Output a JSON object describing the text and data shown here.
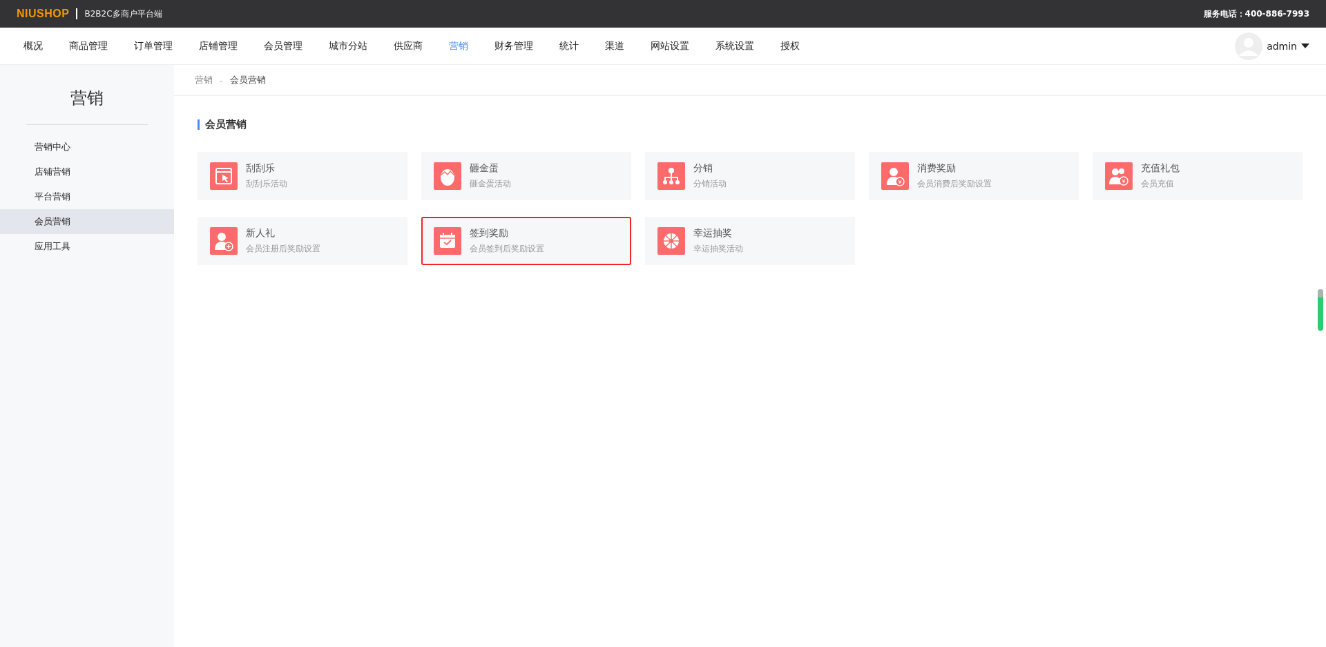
{
  "header": {
    "logo": "NIUSHOP",
    "subtitle": "B2B2C多商户平台端",
    "service_phone": "服务电话：400-886-7993"
  },
  "nav": [
    {
      "label": "概况",
      "selected": false
    },
    {
      "label": "商品管理",
      "selected": false
    },
    {
      "label": "订单管理",
      "selected": false
    },
    {
      "label": "店铺管理",
      "selected": false
    },
    {
      "label": "会员管理",
      "selected": false
    },
    {
      "label": "城市分站",
      "selected": false
    },
    {
      "label": "供应商",
      "selected": false
    },
    {
      "label": "营销",
      "selected": true
    },
    {
      "label": "财务管理",
      "selected": false
    },
    {
      "label": "统计",
      "selected": false
    },
    {
      "label": "渠道",
      "selected": false
    },
    {
      "label": "网站设置",
      "selected": false
    },
    {
      "label": "系统设置",
      "selected": false
    },
    {
      "label": "授权",
      "selected": false
    }
  ],
  "user": {
    "name": "admin"
  },
  "sidebar": {
    "title": "营销",
    "items": [
      {
        "label": "营销中心",
        "selected": false
      },
      {
        "label": "店铺营销",
        "selected": false
      },
      {
        "label": "平台营销",
        "selected": false
      },
      {
        "label": "会员营销",
        "selected": true
      },
      {
        "label": "应用工具",
        "selected": false
      }
    ]
  },
  "breadcrumb": [
    "营销",
    "会员营销"
  ],
  "breadcrumb_separator": "-",
  "section": {
    "title": "会员营销",
    "cards": [
      {
        "kind": "scratch",
        "title": "刮刮乐",
        "description": "刮刮乐活动",
        "highlighted": false
      },
      {
        "kind": "egg",
        "title": "砸金蛋",
        "description": "砸金蛋活动",
        "highlighted": false
      },
      {
        "kind": "distribution",
        "title": "分销",
        "description": "分销活动",
        "highlighted": false
      },
      {
        "kind": "consume",
        "title": "消费奖励",
        "description": "会员消费后奖励设置",
        "highlighted": false
      },
      {
        "kind": "recharge",
        "title": "充值礼包",
        "description": "会员充值",
        "highlighted": false
      },
      {
        "kind": "newuser",
        "title": "新人礼",
        "description": "会员注册后奖励设置",
        "highlighted": false
      },
      {
        "kind": "signin",
        "title": "签到奖励",
        "description": "会员签到后奖励设置",
        "highlighted": true
      },
      {
        "kind": "wheel",
        "title": "幸运抽奖",
        "description": "幸运抽奖活动",
        "highlighted": false
      }
    ]
  }
}
